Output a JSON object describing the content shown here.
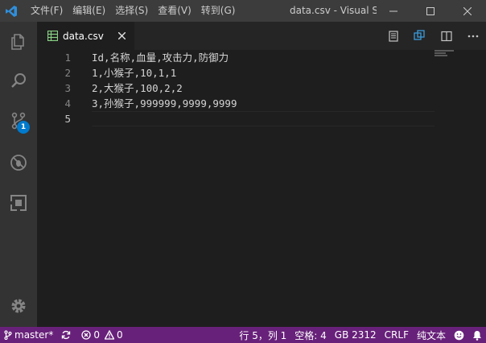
{
  "titlebar": {
    "menus": [
      "文件(F)",
      "编辑(E)",
      "选择(S)",
      "查看(V)",
      "转到(G)"
    ],
    "title": "data.csv - Visual S"
  },
  "activitybar": {
    "icons": [
      "files-icon",
      "search-icon",
      "source-control-icon",
      "debug-icon",
      "extensions-icon",
      "gear-icon"
    ],
    "scm_badge": "1"
  },
  "tabs": [
    {
      "label": "data.csv",
      "icon": "csv-file-icon",
      "active": true
    }
  ],
  "editor": {
    "lines": [
      {
        "number": "1",
        "text": "Id,名称,血量,攻击力,防御力"
      },
      {
        "number": "2",
        "text": "1,小猴子,10,1,1"
      },
      {
        "number": "3",
        "text": "2,大猴子,100,2,2"
      },
      {
        "number": "4",
        "text": "3,孙猴子,999999,9999,9999"
      },
      {
        "number": "5",
        "text": ""
      }
    ],
    "current_line": 5
  },
  "statusbar": {
    "branch": "master*",
    "errors": "0",
    "warnings": "0",
    "position": "行 5，列 1",
    "indent": "空格: 4",
    "encoding": "GB 2312",
    "eol": "CRLF",
    "language": "纯文本"
  },
  "colors": {
    "statusbar": "#68217a",
    "badge": "#007acc",
    "titlebar": "#3c3c3c",
    "activitybar": "#333333",
    "editor": "#1e1e1e"
  }
}
